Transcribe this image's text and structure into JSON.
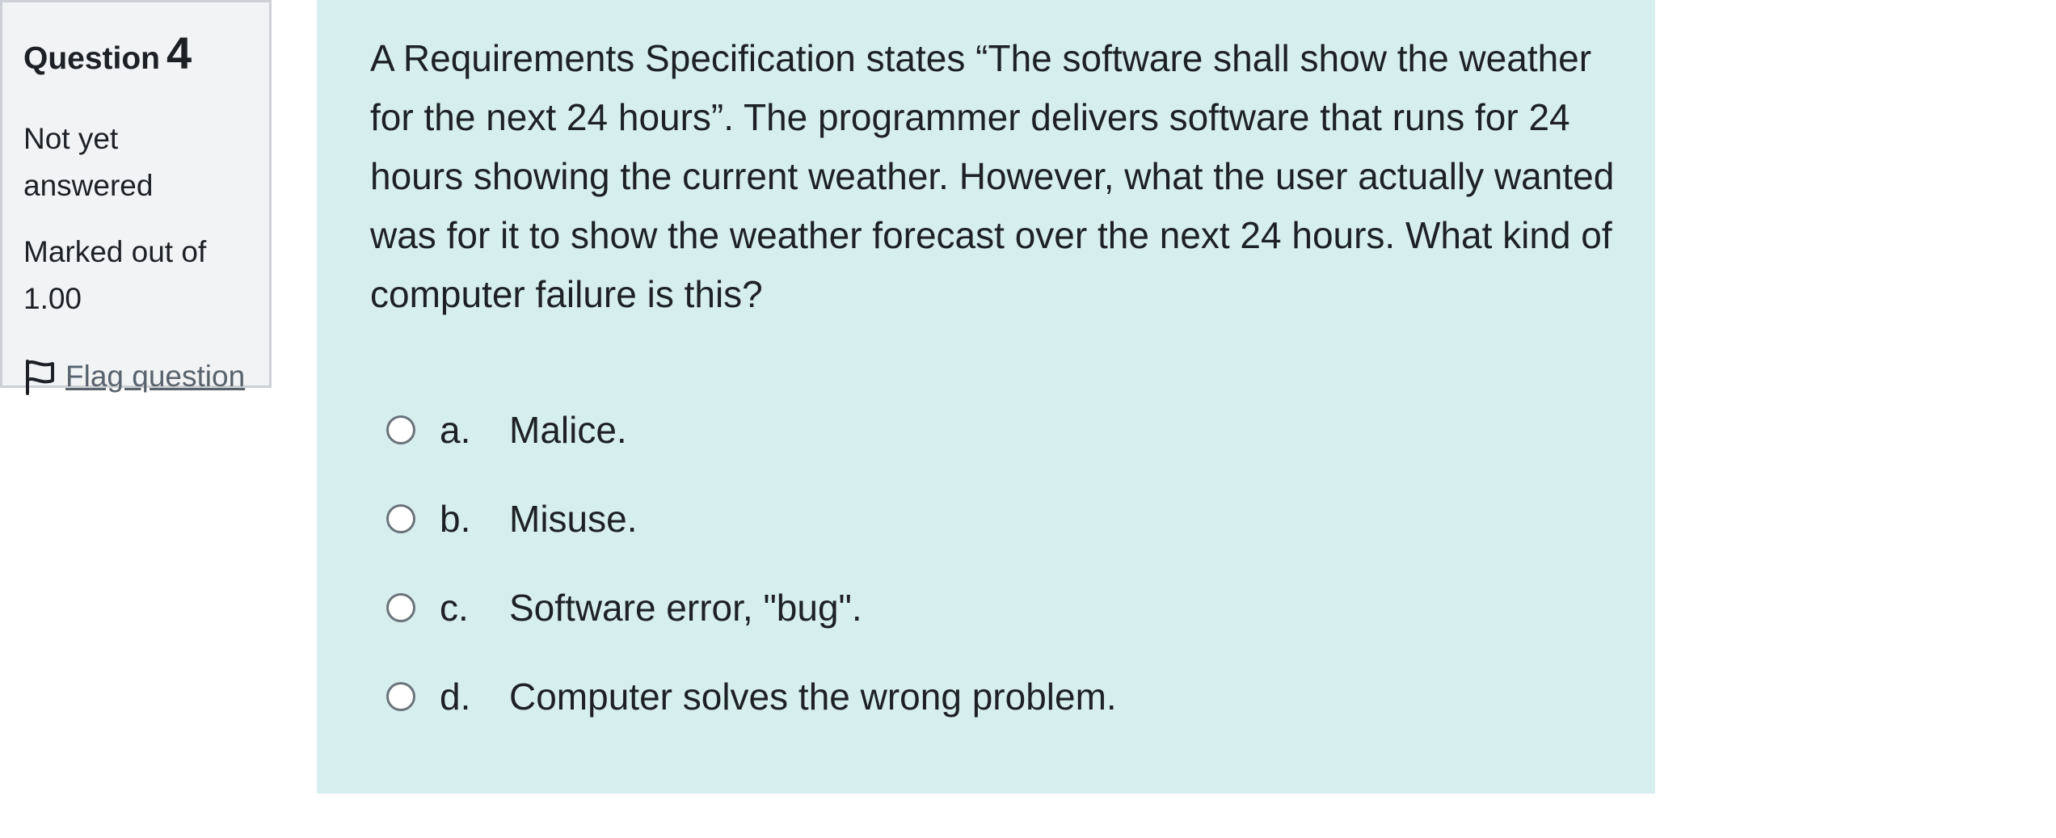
{
  "info": {
    "question_label": "Question",
    "question_number": "4",
    "state": "Not yet answered",
    "grade": "Marked out of 1.00",
    "flag_label": "Flag question"
  },
  "question": {
    "text": "A Requirements Specification states “The software shall show the weather for the next 24 hours”. The programmer delivers software that runs for 24 hours showing the current weather. However, what the user actually wanted was for it to show the weather forecast over the next 24 hours. What kind of computer failure is this?",
    "answers": [
      {
        "letter": "a.",
        "text": "Malice."
      },
      {
        "letter": "b.",
        "text": "Misuse."
      },
      {
        "letter": "c.",
        "text": "Software error, \"bug\"."
      },
      {
        "letter": "d.",
        "text": "Computer solves the wrong problem."
      }
    ]
  },
  "icons": {
    "flag": "flag-icon",
    "radio": "radio-unchecked-icon"
  },
  "colors": {
    "content_background": "#d6eeee",
    "info_background": "#f1f3f5",
    "link": "#58636e"
  }
}
